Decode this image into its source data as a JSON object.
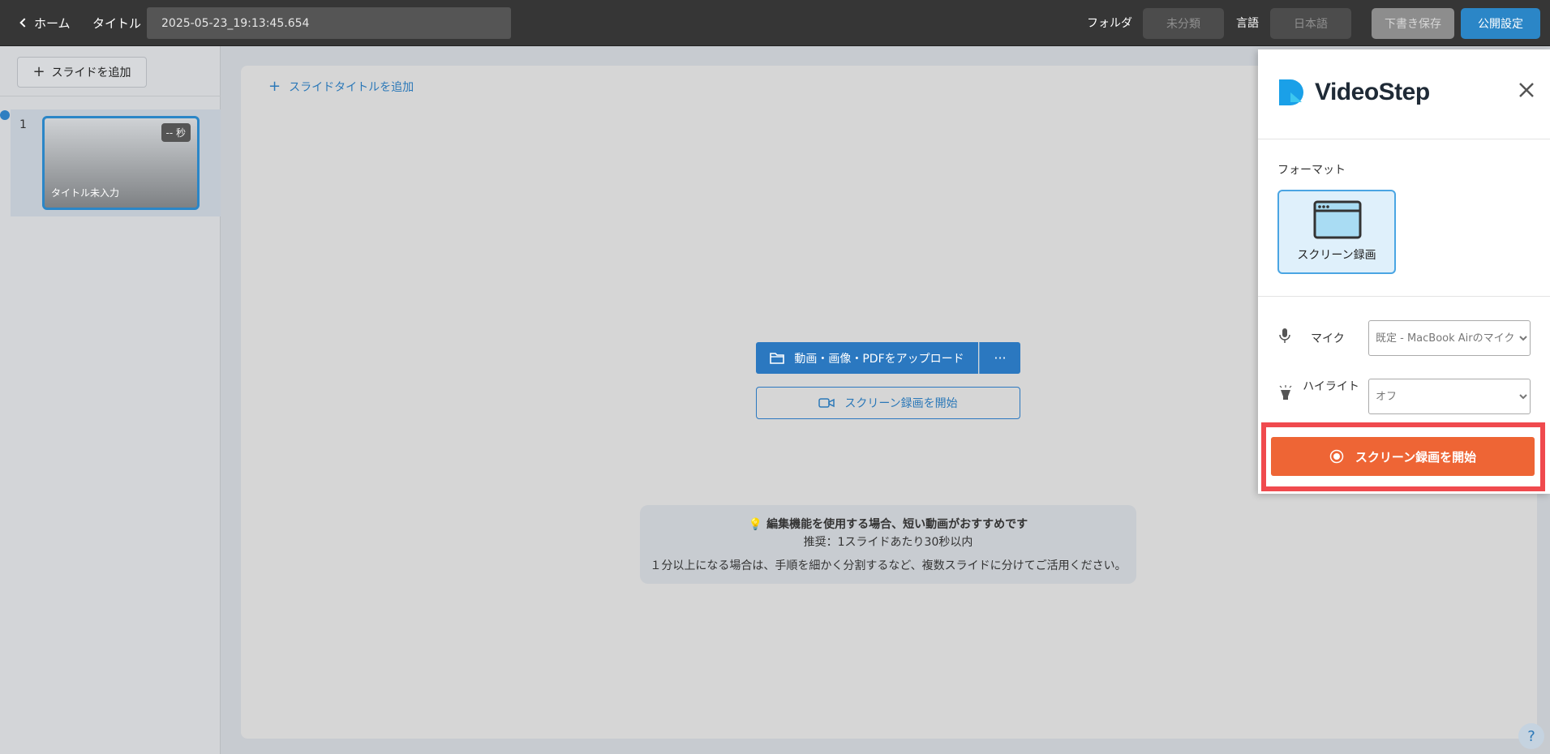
{
  "topbar": {
    "back_label": "ホーム",
    "title_label": "タイトル",
    "title_value": "2025-05-23_19:13:45.654",
    "folder_label": "フォルダ",
    "folder_value": "未分類",
    "language_label": "言語",
    "language_value": "日本語",
    "draft_save_label": "下書き保存",
    "publish_settings_label": "公開設定"
  },
  "sidebar": {
    "add_slide_label": "スライドを追加",
    "slides": [
      {
        "number": "1",
        "duration": "-- 秒",
        "title": "タイトル未入力"
      }
    ]
  },
  "main": {
    "add_slide_title_label": "スライドタイトルを追加",
    "upload_label": "動画・画像・PDFをアップロード",
    "more_label": "···",
    "start_recording_label": "スクリーン録画を開始",
    "tip": {
      "heading": "編集機能を使用する場合、短い動画がおすすめです",
      "line2": "推奨：1スライドあたり30秒以内",
      "line3": "１分以上になる場合は、手順を細かく分割するなど、複数スライドに分けてご活用ください。"
    },
    "help_label": "?"
  },
  "panel": {
    "brand": "VideoStep",
    "format_label": "フォーマット",
    "format_option": "スクリーン録画",
    "mic_label": "マイク",
    "mic_value": "既定 - MacBook Airのマイク",
    "highlight_label": "ハイライト",
    "highlight_value": "オフ",
    "start_button_label": "スクリーン録画を開始"
  },
  "colors": {
    "accent_blue": "#2b78c0",
    "record_orange": "#ee6535",
    "highlight_red": "#f04a4e"
  }
}
